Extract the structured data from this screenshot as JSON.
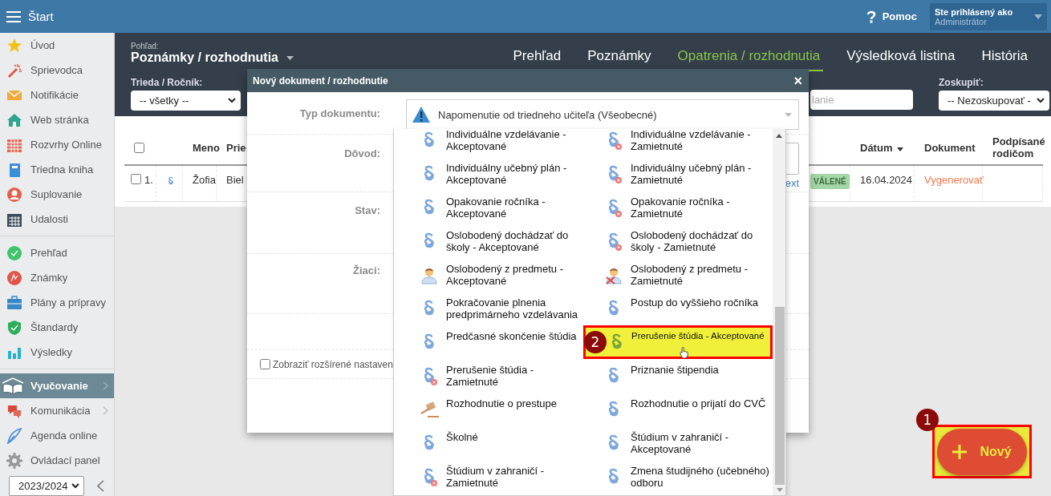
{
  "top_bar": {
    "title": "Štart",
    "help_label": "Pomoc",
    "user_caption": "Ste prihlásený ako",
    "user_name": "Administrátor"
  },
  "sidebar": {
    "groups": [
      {
        "items": [
          {
            "label": "Úvod",
            "selected": false,
            "submenu": false
          },
          {
            "label": "Sprievodca",
            "selected": false,
            "submenu": false
          },
          {
            "label": "Notifikácie",
            "selected": false,
            "submenu": false
          },
          {
            "label": "Web stránka",
            "selected": false,
            "submenu": false
          },
          {
            "label": "Rozvrhy Online",
            "selected": false,
            "submenu": false
          },
          {
            "label": "Triedna kniha",
            "selected": false,
            "submenu": false
          },
          {
            "label": "Suplovanie",
            "selected": false,
            "submenu": false
          },
          {
            "label": "Udalosti",
            "selected": false,
            "submenu": false
          }
        ]
      },
      {
        "items": [
          {
            "label": "Prehľad",
            "selected": false,
            "submenu": false
          },
          {
            "label": "Známky",
            "selected": false,
            "submenu": false
          },
          {
            "label": "Plány a prípravy",
            "selected": false,
            "submenu": false
          },
          {
            "label": "Štandardy",
            "selected": false,
            "submenu": false
          },
          {
            "label": "Výsledky",
            "selected": false,
            "submenu": false
          }
        ]
      },
      {
        "items": [
          {
            "label": "Vyučovanie",
            "selected": true,
            "submenu": true
          },
          {
            "label": "Komunikácia",
            "selected": false,
            "submenu": true
          },
          {
            "label": "Agenda online",
            "selected": false,
            "submenu": false
          },
          {
            "label": "Ovládací panel",
            "selected": false,
            "submenu": false
          }
        ]
      }
    ],
    "year": "2023/2024"
  },
  "header": {
    "view_label": "Pohľad:",
    "view_title": "Poznámky / rozhodnutia",
    "tabs": [
      {
        "label": "Prehľad",
        "selected": false
      },
      {
        "label": "Poznámky",
        "selected": false
      },
      {
        "label": "Opatrenia / rozhodnutia",
        "selected": true
      },
      {
        "label": "Výsledková listina",
        "selected": false
      },
      {
        "label": "História",
        "selected": false
      }
    ],
    "class_label": "Trieda / Ročník:",
    "class_value": "-- všetky --",
    "search_placeholder": "lanie",
    "group_label": "Zoskupiť:",
    "group_value": "-- Nezoskupovať -"
  },
  "table": {
    "select_all_checked": false,
    "columns": [
      {
        "label": "Meno",
        "sorted": false
      },
      {
        "label": "Prie",
        "sorted": false
      },
      {
        "label": "Dátum",
        "sorted": true
      },
      {
        "label": "Dokument",
        "sorted": false
      },
      {
        "label": "Podpísané rodičom",
        "sorted": false
      }
    ],
    "rows": [
      {
        "checked": false,
        "number": "1.",
        "name": "Žofia",
        "column_4": "Biel",
        "status": "VÁLENÉ",
        "date": "16.04.2024",
        "document": "Vygenerovať"
      }
    ]
  },
  "modal": {
    "title": "Nový dokument / rozhodnutie",
    "close": "×",
    "labels": [
      "Typ dokumentu:",
      "Dôvod:",
      "Stav:",
      "Žiaci:"
    ],
    "document_type": "Napomenutie od triedneho učiteľa (Všeobecné)",
    "text_link": "ext",
    "advanced_label": "Zobraziť rozšírené nastaven",
    "advanced_checked": false
  },
  "dropdown": {
    "options": [
      {
        "label": "Individuálne vzdelávanie - Akceptované",
        "kind": "paragraph",
        "rejected": false,
        "selected": false
      },
      {
        "label": "Individuálne vzdelávanie - Zamietnuté",
        "kind": "paragraph",
        "rejected": true,
        "selected": false
      },
      {
        "label": "Individuálny učebný plán - Akceptované",
        "kind": "paragraph",
        "rejected": false,
        "selected": false
      },
      {
        "label": "Individuálny učebný plán - Zamietnuté",
        "kind": "paragraph",
        "rejected": true,
        "selected": false
      },
      {
        "label": "Opakovanie ročníka - Akceptované",
        "kind": "paragraph",
        "rejected": false,
        "selected": false
      },
      {
        "label": "Opakovanie ročníka - Zamietnuté",
        "kind": "paragraph",
        "rejected": true,
        "selected": false
      },
      {
        "label": "Oslobodený dochádzať do školy - Akceptované",
        "kind": "paragraph",
        "rejected": false,
        "selected": false
      },
      {
        "label": "Oslobodený dochádzať do školy - Zamietnuté",
        "kind": "paragraph",
        "rejected": true,
        "selected": false
      },
      {
        "label": "Oslobodený z predmetu - Akceptované",
        "kind": "person",
        "rejected": false,
        "selected": false
      },
      {
        "label": "Oslobodený z predmetu - Zamietnuté",
        "kind": "person",
        "rejected": true,
        "selected": false
      },
      {
        "label": "Pokračovanie plnenia predprimárneho vzdelávania",
        "kind": "paragraph",
        "rejected": false,
        "selected": false
      },
      {
        "label": "Postup do vyššieho ročníka",
        "kind": "paragraph",
        "rejected": false,
        "selected": false
      },
      {
        "label": "Predčasné skončenie štúdia",
        "kind": "paragraph",
        "rejected": false,
        "selected": false
      },
      {
        "label": "Prerušenie štúdia - Akceptované",
        "kind": "paragraph",
        "rejected": false,
        "selected": true
      },
      {
        "label": "Prerušenie štúdia - Zamietnuté",
        "kind": "paragraph",
        "rejected": true,
        "selected": false
      },
      {
        "label": "Priznanie štipendia",
        "kind": "paragraph",
        "rejected": false,
        "selected": false
      },
      {
        "label": "Rozhodnutie o prestupe",
        "kind": "gavel",
        "rejected": false,
        "selected": false
      },
      {
        "label": "Rozhodnutie o prijatí do CVČ",
        "kind": "paragraph",
        "rejected": false,
        "selected": false
      },
      {
        "label": "Školné",
        "kind": "paragraph",
        "rejected": false,
        "selected": false
      },
      {
        "label": "Štúdium v zahraničí - Akceptované",
        "kind": "paragraph",
        "rejected": false,
        "selected": false
      },
      {
        "label": "Štúdium v zahraničí - Zamietnuté",
        "kind": "paragraph",
        "rejected": true,
        "selected": false
      },
      {
        "label": "Zmena študijného (učebného) odboru",
        "kind": "paragraph",
        "rejected": false,
        "selected": false
      }
    ]
  },
  "new_button": {
    "label": "Nový"
  },
  "annotations": [
    {
      "number": "1"
    },
    {
      "number": "2"
    }
  ]
}
